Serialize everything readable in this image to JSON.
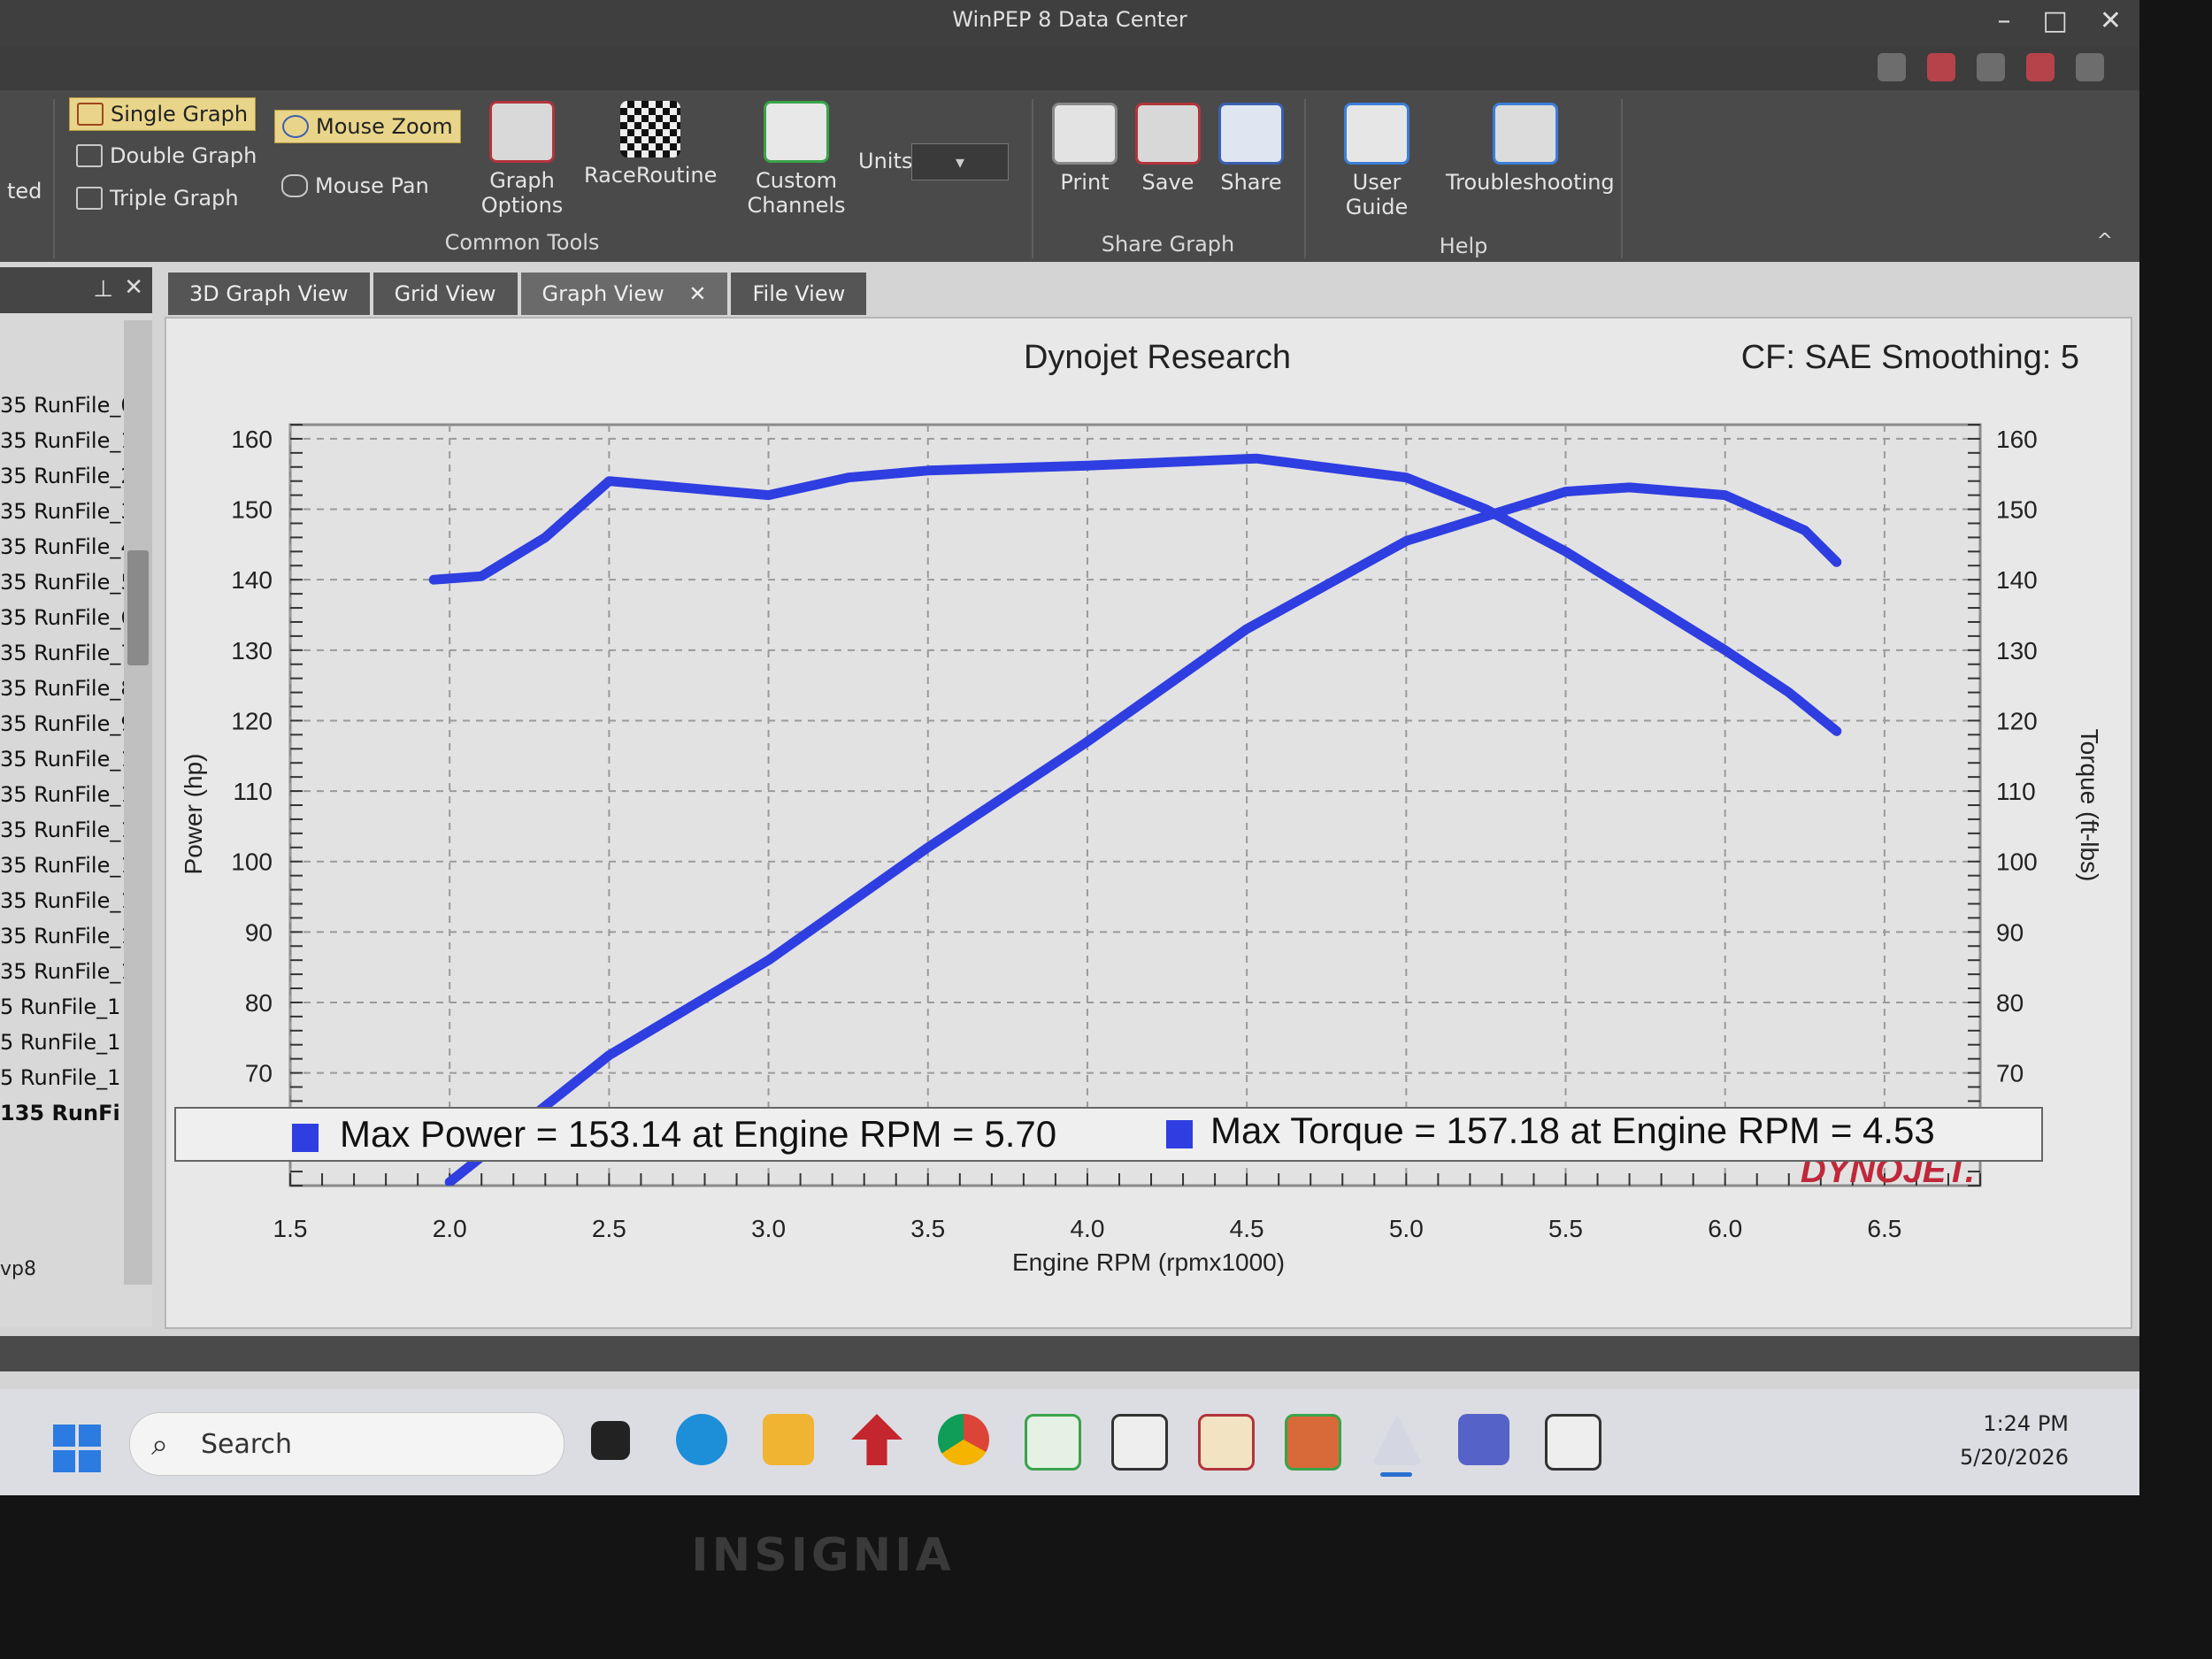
{
  "window": {
    "title": "WinPEP 8 Data Center",
    "controls": [
      "–",
      "□",
      "✕"
    ]
  },
  "ribbon": {
    "left_cut_label": "ted",
    "graph_layout": [
      {
        "label": "Single Graph",
        "active": true
      },
      {
        "label": "Double Graph",
        "active": false
      },
      {
        "label": "Triple Graph",
        "active": false
      }
    ],
    "mouse_zoom": "Mouse Zoom",
    "mouse_pan": "Mouse Pan",
    "graph_options": "Graph\nOptions",
    "race_routine": "RaceRoutine",
    "custom_channels": "Custom\nChannels",
    "units_label": "Units",
    "common_tools_group": "Common Tools",
    "print": "Print",
    "save": "Save",
    "share": "Share",
    "share_graph_group": "Share Graph",
    "user_guide": "User Guide",
    "troubleshooting": "Troubleshooting",
    "help_group": "Help"
  },
  "left_panel": {
    "files": [
      "35 RunFile_0",
      "35 RunFile_1",
      "35 RunFile_2",
      "35 RunFile_3",
      "35 RunFile_4",
      "35 RunFile_5",
      "35 RunFile_6",
      "35 RunFile_7",
      "35 RunFile_8",
      "35 RunFile_9",
      "35 RunFile_1",
      "35 RunFile_1",
      "35 RunFile_1",
      "35 RunFile_1",
      "35 RunFile_1",
      "35 RunFile_1",
      "35 RunFile_1",
      "5 RunFile_1",
      "5 RunFile_1",
      "5 RunFile_1"
    ],
    "selected_file": "135 RunFi",
    "footer": "vp8"
  },
  "tabs": [
    {
      "label": "3D Graph View",
      "active": false
    },
    {
      "label": "Grid View",
      "active": false
    },
    {
      "label": "Graph View",
      "active": true,
      "closable": true
    },
    {
      "label": "File View",
      "active": false
    }
  ],
  "graph": {
    "title": "Dynojet Research",
    "cf_label": "CF: SAE Smoothing: 5",
    "left_axis_label": "Power (hp)",
    "right_axis_label": "Torque (ft-lbs)",
    "x_axis_label": "Engine RPM (rpmx1000)",
    "brand": "DYNOJET.",
    "legend": {
      "power": "Max Power = 153.14 at Engine RPM = 5.70",
      "torque": "Max Torque = 157.18 at Engine RPM = 4.53"
    }
  },
  "chart_data": {
    "type": "line",
    "title": "Dynojet Research",
    "xlabel": "Engine RPM (rpmx1000)",
    "ylabel": "Power (hp)",
    "y2label": "Torque (ft-lbs)",
    "xlim": [
      1.5,
      6.8
    ],
    "ylim": [
      54,
      162
    ],
    "y2lim": [
      54,
      162
    ],
    "x_ticks": [
      1.5,
      2.0,
      2.5,
      3.0,
      3.5,
      4.0,
      4.5,
      5.0,
      5.5,
      6.0,
      6.5
    ],
    "y_ticks": [
      60,
      70,
      80,
      90,
      100,
      110,
      120,
      130,
      140,
      150,
      160
    ],
    "grid": true,
    "series": [
      {
        "axis": "left",
        "color": "#2f3ee0",
        "x": [
          2.0,
          2.5,
          3.0,
          3.5,
          4.0,
          4.5,
          5.0,
          5.5,
          5.7,
          6.0,
          6.25,
          6.35
        ],
        "values": [
          54.5,
          72.5,
          86.0,
          102.0,
          117.0,
          133.0,
          145.5,
          152.5,
          153.1,
          152.0,
          147.0,
          142.5
        ]
      },
      {
        "axis": "right",
        "color": "#2f3ee0",
        "x": [
          1.95,
          2.1,
          2.3,
          2.5,
          2.75,
          3.0,
          3.25,
          3.5,
          4.0,
          4.53,
          5.0,
          5.25,
          5.5,
          5.75,
          6.0,
          6.2,
          6.35
        ],
        "values": [
          140.0,
          140.5,
          146.0,
          154.0,
          153.0,
          152.0,
          154.5,
          155.5,
          156.2,
          157.2,
          154.5,
          150.0,
          144.0,
          137.0,
          130.0,
          124.0,
          118.5
        ]
      }
    ]
  },
  "taskbar": {
    "search_placeholder": "Search",
    "time": "1:24 PM",
    "date": "5/20/2026",
    "pinned": [
      "task-view",
      "edge",
      "file-explorer",
      "red-arrow",
      "chrome",
      "link-tool",
      "mt-bt",
      "dm-bt",
      "vt-bt",
      "winpep",
      "teams",
      "mt-bt-2"
    ]
  },
  "monitor": {
    "brand": "INSIGNIA"
  },
  "colors": {
    "series": "#2f3ee0",
    "active_tool": "#e9d58a",
    "brand": "#c0283a"
  }
}
